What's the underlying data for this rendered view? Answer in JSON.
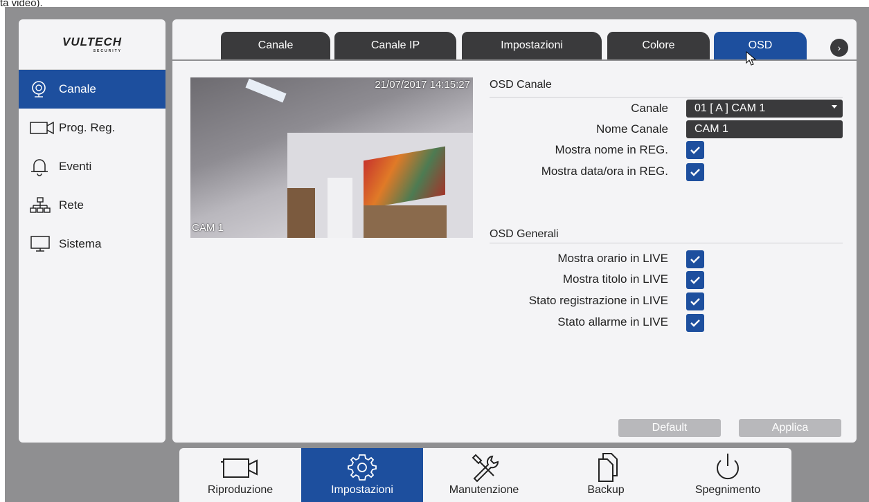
{
  "caption": "ta video).",
  "logo": {
    "brand": "VULTECH",
    "sub": "SECURITY"
  },
  "sidebar": {
    "items": [
      {
        "label": "Canale",
        "icon": "camera-icon",
        "active": true
      },
      {
        "label": "Prog. Reg.",
        "icon": "record-schedule-icon",
        "active": false
      },
      {
        "label": "Eventi",
        "icon": "bell-icon",
        "active": false
      },
      {
        "label": "Rete",
        "icon": "network-icon",
        "active": false
      },
      {
        "label": "Sistema",
        "icon": "monitor-icon",
        "active": false
      }
    ]
  },
  "tabs": [
    {
      "label": "Canale",
      "active": false
    },
    {
      "label": "Canale IP",
      "active": false
    },
    {
      "label": "Impostazioni",
      "active": false
    },
    {
      "label": "Colore",
      "active": false
    },
    {
      "label": "OSD",
      "active": true
    }
  ],
  "tabs_next": "›",
  "preview": {
    "timestamp": "21/07/2017 14:15:27",
    "camera_label": "CAM 1"
  },
  "osd_canale": {
    "title": "OSD Canale",
    "canale_label": "Canale",
    "canale_value": "01 [ A ] CAM 1",
    "nome_label": "Nome Canale",
    "nome_value": "CAM 1",
    "mostra_nome_label": "Mostra nome in REG.",
    "mostra_nome_checked": true,
    "mostra_data_label": "Mostra data/ora in REG.",
    "mostra_data_checked": true
  },
  "osd_generali": {
    "title": "OSD Generali",
    "items": [
      {
        "label": "Mostra orario in LIVE",
        "checked": true
      },
      {
        "label": "Mostra titolo in LIVE",
        "checked": true
      },
      {
        "label": "Stato registrazione in LIVE",
        "checked": true
      },
      {
        "label": "Stato allarme in LIVE",
        "checked": true
      }
    ]
  },
  "buttons": {
    "default": "Default",
    "apply": "Applica"
  },
  "bottombar": [
    {
      "label": "Riproduzione",
      "icon": "video-camera-icon",
      "active": false
    },
    {
      "label": "Impostazioni",
      "icon": "gear-icon",
      "active": true
    },
    {
      "label": "Manutenzione",
      "icon": "tools-icon",
      "active": false
    },
    {
      "label": "Backup",
      "icon": "copy-icon",
      "active": false
    },
    {
      "label": "Spegnimento",
      "icon": "power-icon",
      "active": false
    }
  ],
  "colors": {
    "accent": "#1d4f9e",
    "tab": "#3a3a3c",
    "panel": "#f4f4f6",
    "frame": "#8f8f91"
  }
}
